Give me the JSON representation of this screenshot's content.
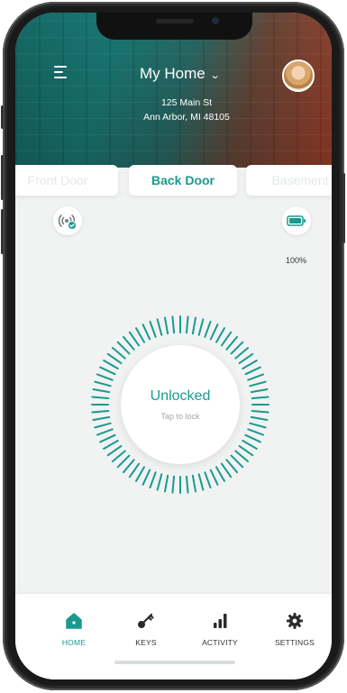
{
  "header": {
    "home_name": "My Home",
    "address_line1": "125 Main St",
    "address_line2": "Ann Arbor, MI 48105"
  },
  "doors": [
    {
      "label": "Front Door",
      "active": false
    },
    {
      "label": "Back Door",
      "active": true
    },
    {
      "label": "Basement",
      "active": false
    }
  ],
  "status": {
    "connection_icon": "wifi-check-icon",
    "battery_icon": "battery-icon",
    "battery_percent": "100%"
  },
  "lock": {
    "state": "Unlocked",
    "hint": "Tap to lock"
  },
  "nav": [
    {
      "label": "HOME",
      "icon": "home-icon",
      "active": true
    },
    {
      "label": "KEYS",
      "icon": "key-icon",
      "active": false
    },
    {
      "label": "ACTIVITY",
      "icon": "bar-chart-icon",
      "active": false
    },
    {
      "label": "SETTINGS",
      "icon": "gear-icon",
      "active": false
    }
  ],
  "colors": {
    "accent": "#1a9a8f",
    "background": "#f1f3f3"
  }
}
